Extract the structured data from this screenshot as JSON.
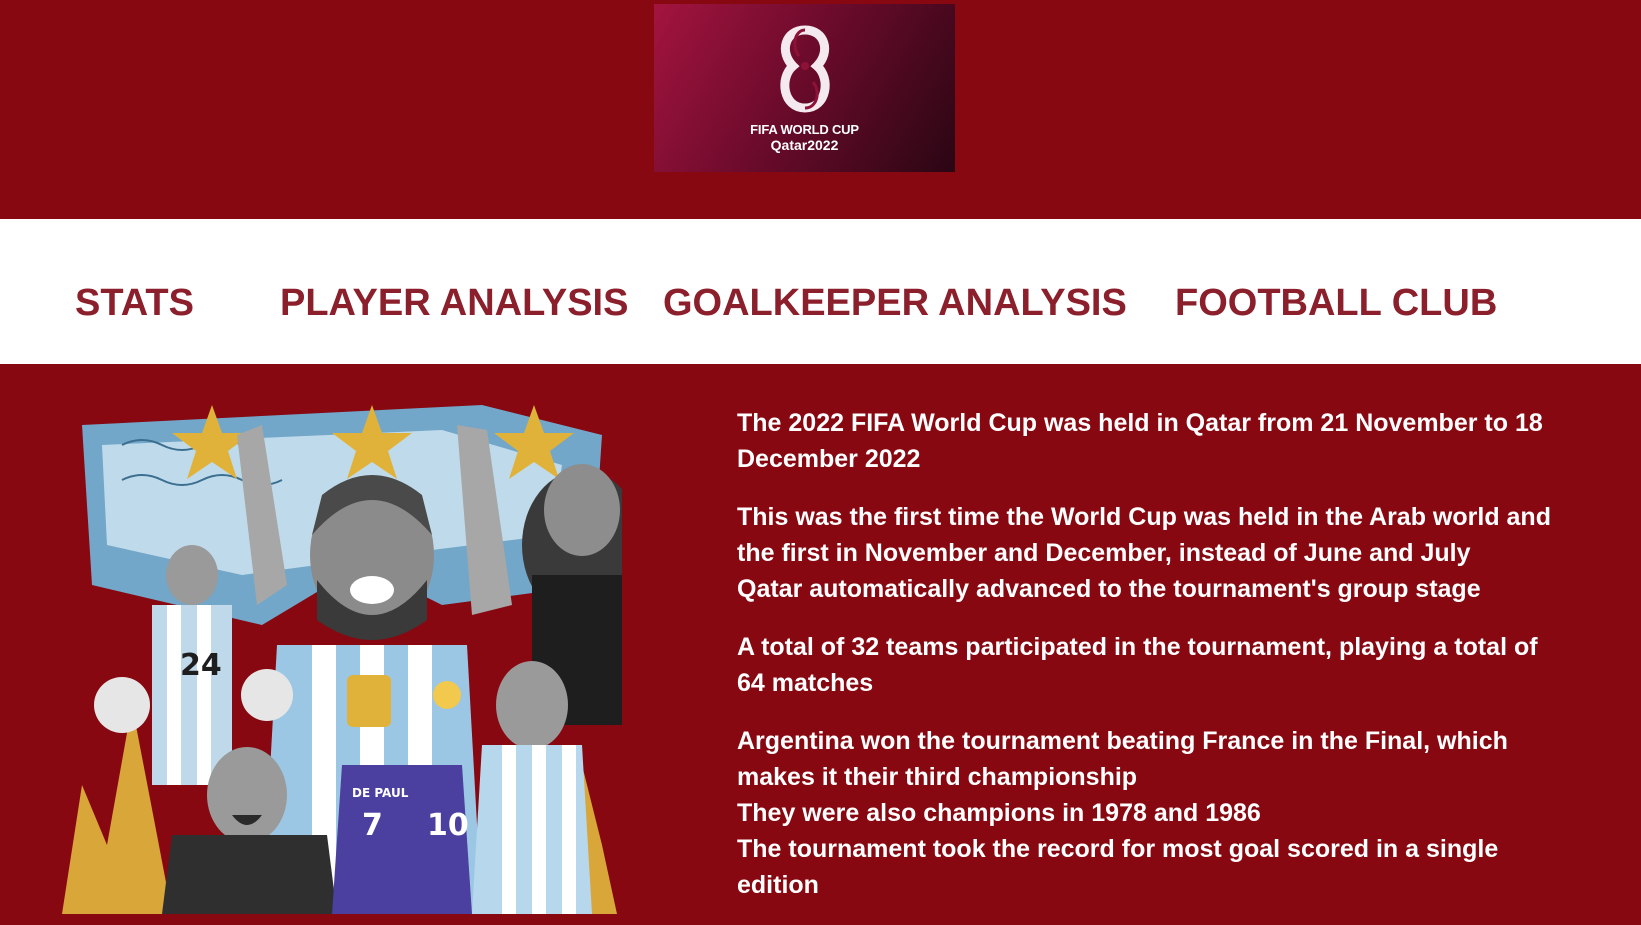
{
  "logo": {
    "line1": "FIFA WORLD CUP",
    "line2": "Qatar2022"
  },
  "nav": {
    "items": [
      {
        "label": "STATS"
      },
      {
        "label": "PLAYER ANALYSIS"
      },
      {
        "label": "GOALKEEPER ANALYSIS"
      },
      {
        "label": "FOOTBALL CLUB"
      }
    ]
  },
  "hero": {
    "jersey_numbers": [
      "7",
      "10",
      "24"
    ],
    "jersey_name": "DE PAUL"
  },
  "content": {
    "paragraphs": [
      {
        "lines": [
          "The 2022 FIFA World Cup was held in Qatar from 21 November to 18",
          "December 2022"
        ]
      },
      {
        "lines": [
          "This was the first time the World Cup was held in the Arab world and",
          "the first in November and December, instead of June and July",
          "Qatar automatically advanced to the tournament's group stage"
        ]
      },
      {
        "lines": [
          "A total of 32 teams participated in the tournament, playing a total of",
          "64 matches"
        ]
      },
      {
        "lines": [
          "Argentina won the tournament beating France in the Final, which",
          "makes it their third championship",
          "They were also champions in 1978 and 1986",
          "The tournament took the record for most goal scored in a single",
          "edition"
        ]
      }
    ]
  },
  "colors": {
    "background": "#870811",
    "nav_background": "#ffffff",
    "nav_text": "#8b1f2b",
    "body_text": "#ffffff",
    "star": "#e0b23a",
    "sky": "#6fc3ea"
  }
}
